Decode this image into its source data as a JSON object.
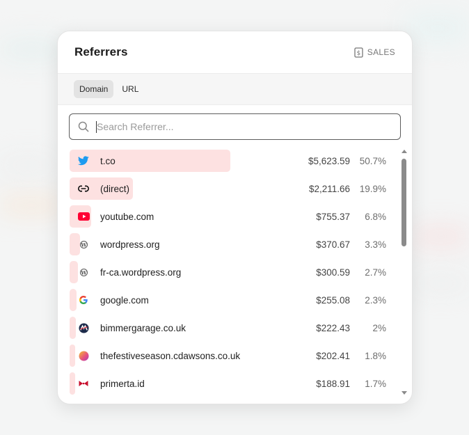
{
  "card": {
    "title": "Referrers",
    "sales_label": "SALES"
  },
  "tabs": [
    {
      "label": "Domain",
      "active": true
    },
    {
      "label": "URL",
      "active": false
    }
  ],
  "search": {
    "placeholder": "Search Referrer...",
    "value": ""
  },
  "colors": {
    "bar": "#fde1e1",
    "twitter": "#1d9bf0",
    "youtube": "#ff0033"
  },
  "rows": [
    {
      "icon": "twitter-icon",
      "name": "t.co",
      "value": "$5,623.59",
      "percent": "50.7%",
      "share": 0.507
    },
    {
      "icon": "link-icon",
      "name": "(direct)",
      "value": "$2,211.66",
      "percent": "19.9%",
      "share": 0.199
    },
    {
      "icon": "youtube-icon",
      "name": "youtube.com",
      "value": "$755.37",
      "percent": "6.8%",
      "share": 0.068
    },
    {
      "icon": "wordpress-icon",
      "name": "wordpress.org",
      "value": "$370.67",
      "percent": "3.3%",
      "share": 0.033
    },
    {
      "icon": "wordpress-icon",
      "name": "fr-ca.wordpress.org",
      "value": "$300.59",
      "percent": "2.7%",
      "share": 0.027
    },
    {
      "icon": "google-icon",
      "name": "google.com",
      "value": "$255.08",
      "percent": "2.3%",
      "share": 0.023
    },
    {
      "icon": "bimmergarage-icon",
      "name": "bimmergarage.co.uk",
      "value": "$222.43",
      "percent": "2%",
      "share": 0.02
    },
    {
      "icon": "festiveseason-icon",
      "name": "thefestiveseason.cdawsons.co.uk",
      "value": "$202.41",
      "percent": "1.8%",
      "share": 0.018
    },
    {
      "icon": "primerta-icon",
      "name": "primerta.id",
      "value": "$188.91",
      "percent": "1.7%",
      "share": 0.017
    }
  ]
}
